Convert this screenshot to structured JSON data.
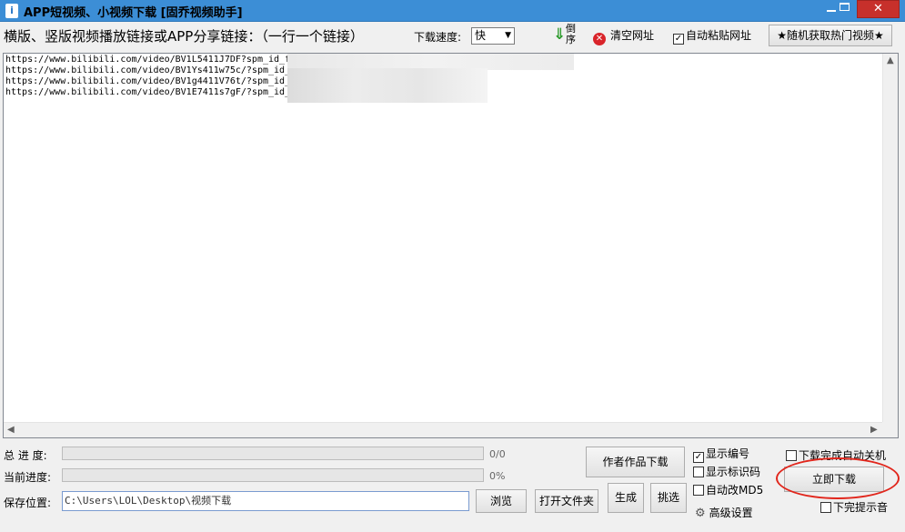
{
  "window": {
    "icon": "info-app-icon",
    "title": "APP短视频、小视频下载 [固乔视频助手]",
    "minimize": "minimize-icon",
    "maximize": "maximize-icon",
    "close": "✕"
  },
  "toolbar": {
    "hint": "横版、竖版视频播放链接或APP分享链接：（一行一个链接）",
    "speed_label": "下载速度:",
    "speed_value": "快",
    "reverse_label": "倒序",
    "clear_label": "清空网址",
    "auto_paste_label": "自动粘贴网址",
    "auto_paste_checked": true,
    "random_label": "★随机获取热门视频★"
  },
  "links": [
    "https://www.bilibili.com/video/BV1L5411J7DF?spm_id_f",
    "https://www.bilibili.com/video/BV1Ys411w75c/?spm_id_",
    "https://www.bilibili.com/video/BV1g4411V76t/?spm_id_",
    "https://www.bilibili.com/video/BV1E7411s7gF/?spm_id_"
  ],
  "progress": {
    "total_label": "总 进 度:",
    "total_text": "0/0",
    "total_value": 0,
    "current_label": "当前进度:",
    "current_text": "0%",
    "current_value": 0
  },
  "save": {
    "label": "保存位置:",
    "path": "C:\\Users\\LOL\\Desktop\\视频下载",
    "browse": "浏览",
    "open_folder": "打开文件夹"
  },
  "actions": {
    "author_download": "作者作品下载",
    "generate": "生成",
    "pick": "挑选",
    "download_now": "立即下载"
  },
  "options": {
    "show_number": "显示编号",
    "show_number_checked": true,
    "show_id": "显示标识码",
    "show_id_checked": false,
    "auto_md5": "自动改MD5",
    "auto_md5_checked": false,
    "advanced": "高级设置",
    "shutdown": "下载完成自动关机",
    "shutdown_checked": false,
    "sound": "下完提示音",
    "sound_checked": false
  },
  "colors": {
    "titlebar": "#3c8ed6",
    "close": "#c7302b",
    "highlight_circle": "#e1261c"
  }
}
